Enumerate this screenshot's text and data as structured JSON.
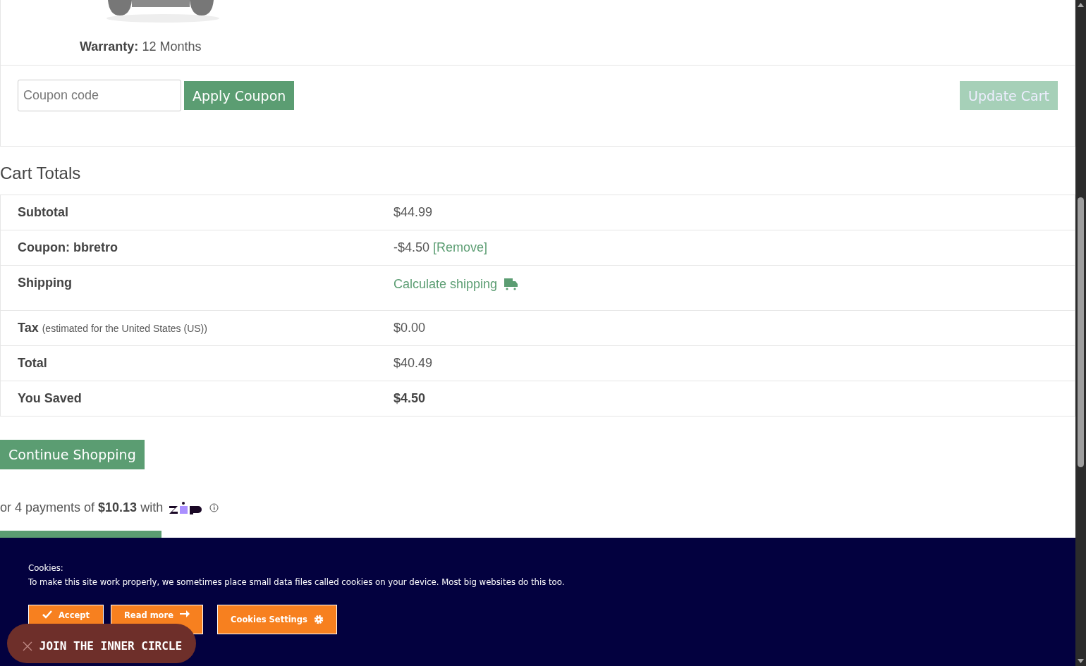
{
  "product": {
    "warranty_label": "Warranty:",
    "warranty_value": "12 Months"
  },
  "coupon": {
    "placeholder": "Coupon code",
    "apply_button": {
      "label": "Apply Coupon",
      "disabled": false
    },
    "update_button": {
      "label": "Update Cart",
      "disabled": true
    }
  },
  "cart_totals": {
    "title": "Cart Totals",
    "rows": [
      {
        "kind": "plain",
        "label": "Subtotal",
        "value": "$44.99"
      },
      {
        "kind": "coupon",
        "label": "Coupon: bbretro",
        "value": "-$4.50",
        "link": "[Remove]"
      },
      {
        "kind": "shipping",
        "label": "Shipping",
        "link": "Calculate shipping"
      },
      {
        "kind": "tax",
        "label": "Tax",
        "note": "(estimated for the United States (US))",
        "value": "$0.00"
      },
      {
        "kind": "plain",
        "label": "Total",
        "value": "$40.49"
      },
      {
        "kind": "strong",
        "label": "You Saved",
        "value": "$4.50"
      }
    ]
  },
  "continue_button": "Continue Shopping",
  "installments": {
    "prefix": "or 4 payments of",
    "amount": "$10.13",
    "suffix": "with"
  },
  "cookie_banner": {
    "title": "Cookies:",
    "text": "To make this site work properly, we sometimes place small data files called cookies on your device. Most big websites do this too.",
    "buttons": [
      {
        "kind": "accept",
        "label": "Accept"
      },
      {
        "kind": "read",
        "label": "Read more"
      },
      {
        "kind": "settings",
        "label": "Cookies Settings"
      }
    ]
  },
  "promo_pill": {
    "label": "JOIN THE INNER CIRCLE"
  }
}
